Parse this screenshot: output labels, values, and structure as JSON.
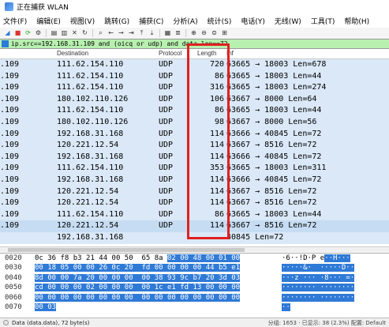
{
  "window": {
    "title": "正在捕获 WLAN"
  },
  "menu": [
    "文件(F)",
    "编辑(E)",
    "视图(V)",
    "跳转(G)",
    "捕获(C)",
    "分析(A)",
    "统计(S)",
    "电话(Y)",
    "无线(W)",
    "工具(T)",
    "帮助(H)"
  ],
  "toolbar_icons": [
    "shark-fin-icon",
    "stop-icon",
    "restart-icon",
    "options-icon",
    "open-icon",
    "file-icon",
    "close-icon",
    "reload-icon",
    "find-icon",
    "back-icon",
    "forward-icon",
    "go-icon",
    "top-icon",
    "bottom-icon",
    "colorize-icon",
    "autoscroll-icon",
    "zoom-in-icon",
    "zoom-out-icon",
    "zoom-reset-icon",
    "resize-columns-icon"
  ],
  "filter": {
    "text": "ip.src==192.168.31.109 and (oicq or udp) and data.len==72"
  },
  "columns": {
    "destination": "Destination",
    "protocol": "Protocol",
    "length": "Length",
    "info": "Inf"
  },
  "packets": [
    {
      "src": ".109",
      "dst": "111.62.154.110",
      "proto": "UDP",
      "len": "720",
      "info": "63665 → 18003 Len=678"
    },
    {
      "src": ".109",
      "dst": "111.62.154.110",
      "proto": "UDP",
      "len": "86",
      "info": "63665 → 18003 Len=44"
    },
    {
      "src": ".109",
      "dst": "111.62.154.110",
      "proto": "UDP",
      "len": "316",
      "info": "63665 → 18003 Len=274"
    },
    {
      "src": ".109",
      "dst": "180.102.110.126",
      "proto": "UDP",
      "len": "106",
      "info": "63667 → 8000 Len=64"
    },
    {
      "src": ".109",
      "dst": "111.62.154.110",
      "proto": "UDP",
      "len": "86",
      "info": "63665 → 18003 Len=44"
    },
    {
      "src": ".109",
      "dst": "180.102.110.126",
      "proto": "UDP",
      "len": "98",
      "info": "63667 → 8000 Len=56"
    },
    {
      "src": ".109",
      "dst": "192.168.31.168",
      "proto": "UDP",
      "len": "114",
      "info": "63666 → 40845 Len=72"
    },
    {
      "src": ".109",
      "dst": "120.221.12.54",
      "proto": "UDP",
      "len": "114",
      "info": "63667 → 8516 Len=72"
    },
    {
      "src": ".109",
      "dst": "192.168.31.168",
      "proto": "UDP",
      "len": "114",
      "info": "63666 → 40845 Len=72"
    },
    {
      "src": ".109",
      "dst": "111.62.154.110",
      "proto": "UDP",
      "len": "353",
      "info": "63665 → 18003 Len=311"
    },
    {
      "src": ".109",
      "dst": "192.168.31.168",
      "proto": "UDP",
      "len": "114",
      "info": "63666 → 40845 Len=72"
    },
    {
      "src": ".109",
      "dst": "120.221.12.54",
      "proto": "UDP",
      "len": "114",
      "info": "63667 → 8516 Len=72"
    },
    {
      "src": ".109",
      "dst": "120.221.12.54",
      "proto": "UDP",
      "len": "114",
      "info": "63667 → 8516 Len=72"
    },
    {
      "src": ".109",
      "dst": "111.62.154.110",
      "proto": "UDP",
      "len": "86",
      "info": "63665 → 18003 Len=44"
    },
    {
      "src": ".109",
      "dst": "120.221.12.54",
      "proto": "UDP",
      "len": "114",
      "info": "63667 → 8516 Len=72"
    },
    {
      "src": "",
      "dst": "192.168.31.168",
      "proto": "",
      "len": "",
      "info": "40845 Len=72"
    }
  ],
  "hex": [
    {
      "off": "0020",
      "plain": "0c 36 f8 b3 21 44 00 50  65 8a ",
      "hl": "02 00 48 00 01 00",
      "ascii_plain": "·6··!D·P e",
      "ascii_hl": "··H···"
    },
    {
      "off": "0030",
      "plain": "",
      "hl": "00 18 05 00 00 26 0c 20  fd 00 00 00 00 44 b5 e1",
      "ascii_plain": "",
      "ascii_hl": "·····&·  ·····D··"
    },
    {
      "off": "0040",
      "plain": "",
      "hl": "8d 00 00 7a 20 00 00 00  00 38 93 9c b7 20 3d 03",
      "ascii_plain": "",
      "ascii_hl": "···z ··· ·8··· =·"
    },
    {
      "off": "0050",
      "plain": "",
      "hl": "cd 00 00 00 02 00 00 00  00 1c e1 fd 13 00 00 00",
      "ascii_plain": "",
      "ascii_hl": "········ ········"
    },
    {
      "off": "0060",
      "plain": "",
      "hl": "00 00 00 00 00 00 00 00  00 00 00 00 00 00 00 00",
      "ascii_plain": "",
      "ascii_hl": "········ ········"
    },
    {
      "off": "0070",
      "plain": "",
      "hl": "00 03",
      "ascii_plain": "",
      "ascii_hl": "··"
    }
  ],
  "status": {
    "left": "Data (data.data), 72 byte(s)",
    "right": "分组: 1653 · 已显示: 38 (2.3%)    配置: Default"
  }
}
